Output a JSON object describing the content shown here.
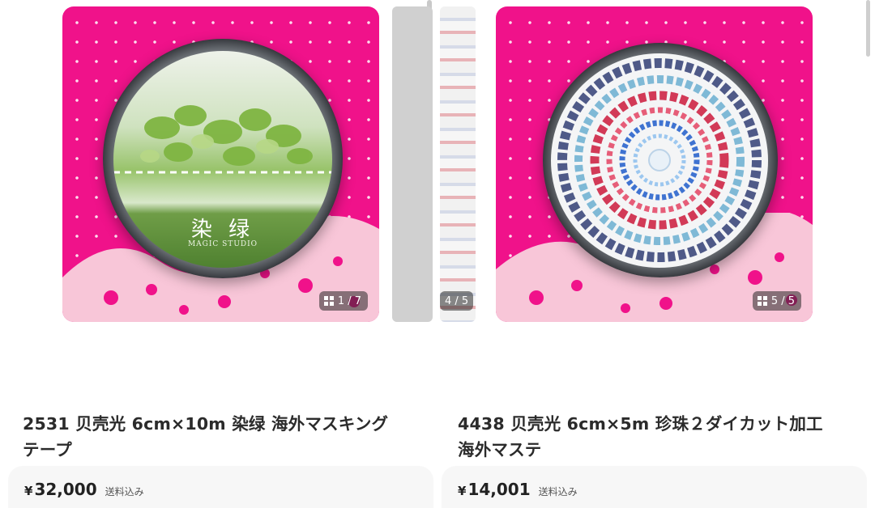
{
  "items": [
    {
      "title_line1": "2531 贝壳光 6cm×10m 染绿 海外マスキング",
      "title_line2": "テープ",
      "currency": "¥",
      "price": "32,000",
      "shipping": "送料込み",
      "image_counter": "1 / 7",
      "tape_label": "染 绿",
      "tape_sublabel": "MAGIC STUDIO"
    },
    {
      "title_line1": "4438 贝壳光 6cm×5m 珍珠２ダイカット加工",
      "title_line2": "海外マステ",
      "currency": "¥",
      "price": "14,001",
      "shipping": "送料込み",
      "image_counter": "5 / 5"
    }
  ],
  "middle_counter": "4 / 5",
  "colors": {
    "card_background": "#f0128a",
    "price_card": "#f7f7f7",
    "text": "#2b2b2b"
  }
}
